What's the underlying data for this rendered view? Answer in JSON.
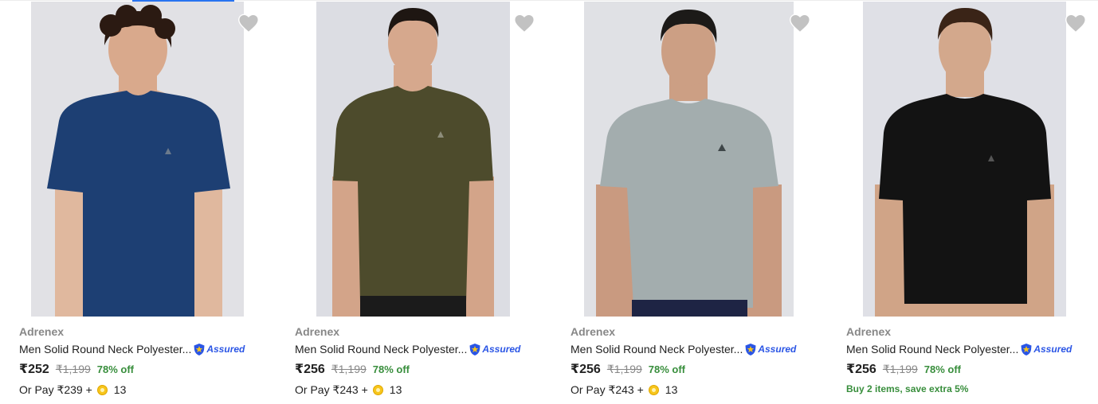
{
  "colors": {
    "accent": "#2874f0",
    "discount_green": "#388e3c",
    "assured_blue": "#2a55e5"
  },
  "products": [
    {
      "brand": "Adrenex",
      "title": "Men Solid Round Neck Polyester...",
      "assured_label": "Assured",
      "price": "₹252",
      "mrp": "₹1,199",
      "discount": "78% off",
      "pay_prefix": "Or Pay ₹239 +",
      "coins": "13",
      "offer": "",
      "shirt_color": "#1d3f73",
      "heart_icon": "heart-icon"
    },
    {
      "brand": "Adrenex",
      "title": "Men Solid Round Neck Polyester...",
      "assured_label": "Assured",
      "price": "₹256",
      "mrp": "₹1,199",
      "discount": "78% off",
      "pay_prefix": "Or Pay ₹243 +",
      "coins": "13",
      "offer": "",
      "shirt_color": "#4d4b2c",
      "heart_icon": "heart-icon"
    },
    {
      "brand": "Adrenex",
      "title": "Men Solid Round Neck Polyester...",
      "assured_label": "Assured",
      "price": "₹256",
      "mrp": "₹1,199",
      "discount": "78% off",
      "pay_prefix": "Or Pay ₹243 +",
      "coins": "13",
      "offer": "",
      "shirt_color": "#a3adae",
      "heart_icon": "heart-icon"
    },
    {
      "brand": "Adrenex",
      "title": "Men Solid Round Neck Polyester...",
      "assured_label": "Assured",
      "price": "₹256",
      "mrp": "₹1,199",
      "discount": "78% off",
      "pay_prefix": "",
      "coins": "",
      "offer": "Buy 2 items, save extra 5%",
      "shirt_color": "#131313",
      "heart_icon": "heart-icon"
    }
  ]
}
